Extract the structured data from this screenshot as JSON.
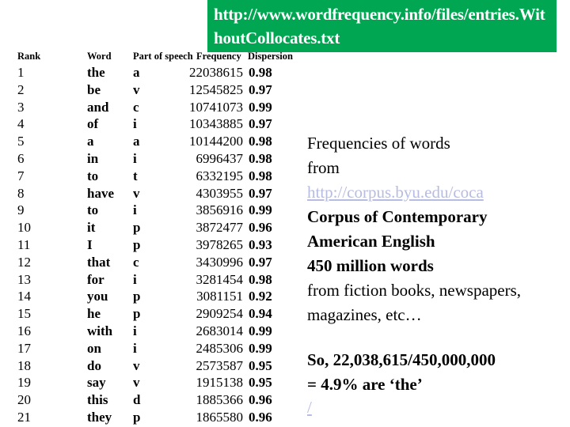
{
  "banner": {
    "url_text": "http://www.wordfrequency.info/files/entries.WithoutCollocates.txt",
    "url_line1": "http://www.wordfrequency.info/files/entri",
    "url_line2": "es.Without.Collocates.txt",
    "background_color": "#00a651",
    "text_color": "#ffffff"
  },
  "table": {
    "headers": {
      "rank": "Rank",
      "word": "Word",
      "pos": "Part of speech",
      "frequency": "Frequency",
      "dispersion": "Dispersion"
    },
    "rows": [
      {
        "rank": "1",
        "word": "the",
        "pos": "a",
        "frequency": "22038615",
        "dispersion": "0.98"
      },
      {
        "rank": "2",
        "word": "be",
        "pos": "v",
        "frequency": "12545825",
        "dispersion": "0.97"
      },
      {
        "rank": "3",
        "word": "and",
        "pos": "c",
        "frequency": "10741073",
        "dispersion": "0.99"
      },
      {
        "rank": "4",
        "word": "of",
        "pos": "i",
        "frequency": "10343885",
        "dispersion": "0.97"
      },
      {
        "rank": "5",
        "word": "a",
        "pos": "a",
        "frequency": "10144200",
        "dispersion": "0.98"
      },
      {
        "rank": "6",
        "word": "in",
        "pos": "i",
        "frequency": "6996437",
        "dispersion": "0.98"
      },
      {
        "rank": "7",
        "word": "to",
        "pos": "t",
        "frequency": "6332195",
        "dispersion": "0.98"
      },
      {
        "rank": "8",
        "word": "have",
        "pos": "v",
        "frequency": "4303955",
        "dispersion": "0.97"
      },
      {
        "rank": "9",
        "word": "to",
        "pos": "i",
        "frequency": "3856916",
        "dispersion": "0.99"
      },
      {
        "rank": "10",
        "word": "it",
        "pos": "p",
        "frequency": "3872477",
        "dispersion": "0.96"
      },
      {
        "rank": "11",
        "word": "I",
        "pos": "p",
        "frequency": "3978265",
        "dispersion": "0.93"
      },
      {
        "rank": "12",
        "word": "that",
        "pos": "c",
        "frequency": "3430996",
        "dispersion": "0.97"
      },
      {
        "rank": "13",
        "word": "for",
        "pos": "i",
        "frequency": "3281454",
        "dispersion": "0.98"
      },
      {
        "rank": "14",
        "word": "you",
        "pos": "p",
        "frequency": "3081151",
        "dispersion": "0.92"
      },
      {
        "rank": "15",
        "word": "he",
        "pos": "p",
        "frequency": "2909254",
        "dispersion": "0.94"
      },
      {
        "rank": "16",
        "word": "with",
        "pos": "i",
        "frequency": "2683014",
        "dispersion": "0.99"
      },
      {
        "rank": "17",
        "word": "on",
        "pos": "i",
        "frequency": "2485306",
        "dispersion": "0.99"
      },
      {
        "rank": "18",
        "word": "do",
        "pos": "v",
        "frequency": "2573587",
        "dispersion": "0.95"
      },
      {
        "rank": "19",
        "word": "say",
        "pos": "v",
        "frequency": "1915138",
        "dispersion": "0.95"
      },
      {
        "rank": "20",
        "word": "this",
        "pos": "d",
        "frequency": "1885366",
        "dispersion": "0.96"
      },
      {
        "rank": "21",
        "word": "they",
        "pos": "p",
        "frequency": "1865580",
        "dispersion": "0.96"
      }
    ]
  },
  "description": {
    "line1": "Frequencies of words",
    "line2": "from",
    "corpus_link": "http://corpus.byu.edu/coca",
    "corpus_link_color": "#b6bce2",
    "line3": "Corpus of Contemporary",
    "line4": "American English",
    "line5": "450 million words",
    "line6": "from fiction books, newspapers,",
    "line7": "magazines, etc…",
    "calc_line1": "So, 22,038,615/450,000,000",
    "calc_line2": "= 4.9%   are ‘the’",
    "trailing_link": "/"
  }
}
